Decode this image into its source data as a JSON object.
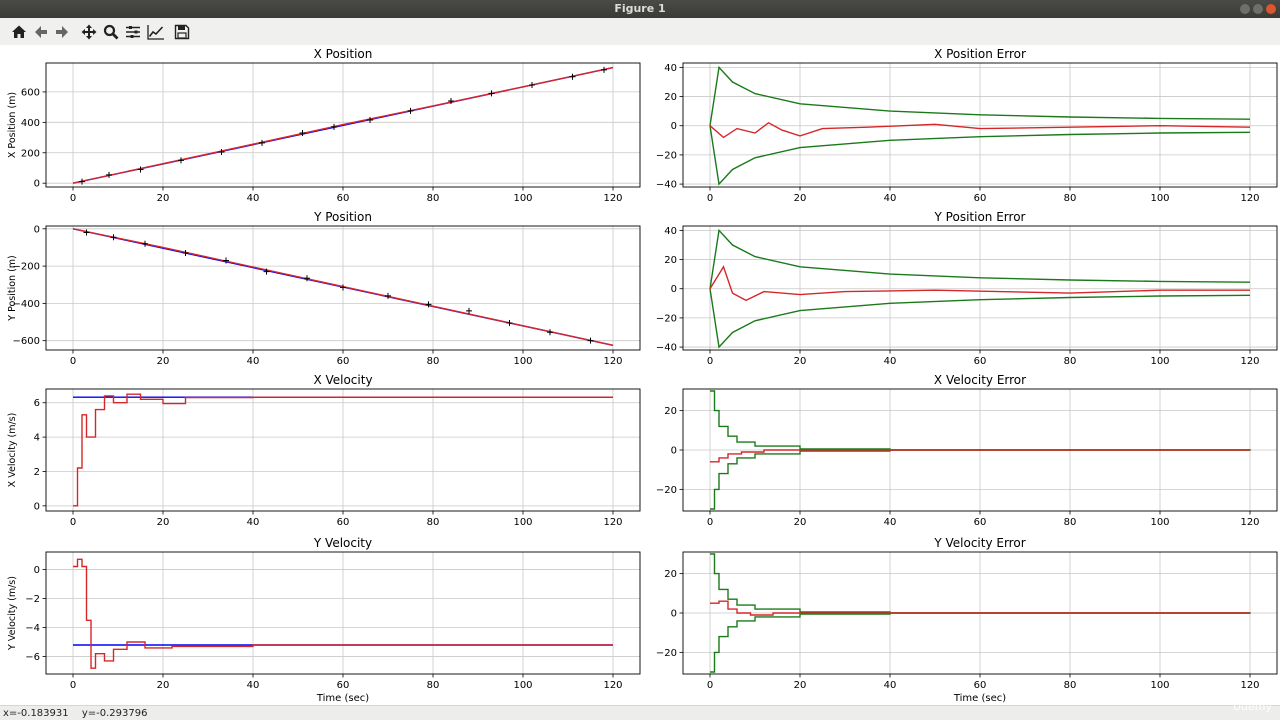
{
  "window": {
    "title": "Figure 1"
  },
  "toolbar": {
    "buttons": [
      {
        "name": "home-icon"
      },
      {
        "name": "back-icon"
      },
      {
        "name": "forward-icon"
      },
      {
        "name": "pan-icon"
      },
      {
        "name": "zoom-icon"
      },
      {
        "name": "subplots-icon"
      },
      {
        "name": "edit-axes-icon"
      },
      {
        "name": "save-icon"
      }
    ]
  },
  "status": {
    "x": "x=-0.183931",
    "y": "y=-0.293796"
  },
  "watermark": "Udemy",
  "colors": {
    "estimate": "#d62728",
    "truth": "#0000ff",
    "measurement": "#000000",
    "bounds": "#1a7a1a"
  },
  "chart_data": [
    {
      "type": "line",
      "title": "X Position",
      "xlabel": "",
      "ylabel": "X Position (m)",
      "xlim": [
        -6,
        126
      ],
      "ylim": [
        -25,
        790
      ],
      "xticks": [
        0,
        20,
        40,
        60,
        80,
        100,
        120
      ],
      "yticks": [
        0,
        200,
        400,
        600
      ],
      "series": [
        {
          "role": "truth",
          "points": [
            [
              0,
              0
            ],
            [
              120,
              760
            ]
          ]
        },
        {
          "role": "estimate",
          "points": [
            [
              0,
              0
            ],
            [
              20,
              128
            ],
            [
              40,
              256
            ],
            [
              60,
              385
            ],
            [
              80,
              508
            ],
            [
              100,
              633
            ],
            [
              120,
              760
            ]
          ]
        },
        {
          "role": "measurement",
          "points": [
            [
              2,
              10
            ],
            [
              8,
              55
            ],
            [
              15,
              90
            ],
            [
              24,
              150
            ],
            [
              33,
              205
            ],
            [
              42,
              265
            ],
            [
              51,
              330
            ],
            [
              58,
              370
            ],
            [
              66,
              415
            ],
            [
              75,
              475
            ],
            [
              84,
              540
            ],
            [
              93,
              590
            ],
            [
              102,
              645
            ],
            [
              111,
              700
            ],
            [
              118,
              745
            ]
          ]
        }
      ]
    },
    {
      "type": "line",
      "title": "X Position Error",
      "xlabel": "",
      "ylabel": "",
      "xlim": [
        -6,
        126
      ],
      "ylim": [
        -42,
        43
      ],
      "xticks": [
        0,
        20,
        40,
        60,
        80,
        100,
        120
      ],
      "yticks": [
        -40,
        -20,
        0,
        20,
        40
      ],
      "series": [
        {
          "role": "bound_upper",
          "points": [
            [
              0,
              0
            ],
            [
              2,
              40
            ],
            [
              5,
              30
            ],
            [
              10,
              22
            ],
            [
              20,
              15
            ],
            [
              40,
              10
            ],
            [
              60,
              7.5
            ],
            [
              80,
              6
            ],
            [
              100,
              5
            ],
            [
              120,
              4.5
            ]
          ]
        },
        {
          "role": "bound_lower",
          "points": [
            [
              0,
              0
            ],
            [
              2,
              -40
            ],
            [
              5,
              -30
            ],
            [
              10,
              -22
            ],
            [
              20,
              -15
            ],
            [
              40,
              -10
            ],
            [
              60,
              -7.5
            ],
            [
              80,
              -6
            ],
            [
              100,
              -5
            ],
            [
              120,
              -4.5
            ]
          ]
        },
        {
          "role": "estimate",
          "points": [
            [
              0,
              0
            ],
            [
              3,
              -8
            ],
            [
              6,
              -2
            ],
            [
              10,
              -5
            ],
            [
              13,
              2
            ],
            [
              16,
              -3
            ],
            [
              20,
              -7
            ],
            [
              25,
              -2
            ],
            [
              35,
              -1
            ],
            [
              50,
              1
            ],
            [
              60,
              -2
            ],
            [
              80,
              -1
            ],
            [
              100,
              0
            ],
            [
              120,
              -1
            ]
          ]
        }
      ]
    },
    {
      "type": "line",
      "title": "Y Position",
      "xlabel": "",
      "ylabel": "Y Position (m)",
      "xlim": [
        -6,
        126
      ],
      "ylim": [
        -650,
        15
      ],
      "xticks": [
        0,
        20,
        40,
        60,
        80,
        100,
        120
      ],
      "yticks": [
        0,
        -200,
        -400,
        -600
      ],
      "series": [
        {
          "role": "truth",
          "points": [
            [
              0,
              0
            ],
            [
              120,
              -625
            ]
          ]
        },
        {
          "role": "estimate",
          "points": [
            [
              0,
              0
            ],
            [
              20,
              -100
            ],
            [
              40,
              -205
            ],
            [
              60,
              -310
            ],
            [
              80,
              -415
            ],
            [
              100,
              -520
            ],
            [
              120,
              -625
            ]
          ]
        },
        {
          "role": "measurement",
          "points": [
            [
              3,
              -20
            ],
            [
              9,
              -45
            ],
            [
              16,
              -80
            ],
            [
              25,
              -130
            ],
            [
              34,
              -170
            ],
            [
              43,
              -230
            ],
            [
              52,
              -265
            ],
            [
              60,
              -315
            ],
            [
              70,
              -360
            ],
            [
              79,
              -405
            ],
            [
              88,
              -440
            ],
            [
              97,
              -505
            ],
            [
              106,
              -555
            ],
            [
              115,
              -600
            ]
          ]
        }
      ]
    },
    {
      "type": "line",
      "title": "Y Position Error",
      "xlabel": "",
      "ylabel": "",
      "xlim": [
        -6,
        126
      ],
      "ylim": [
        -42,
        43
      ],
      "xticks": [
        0,
        20,
        40,
        60,
        80,
        100,
        120
      ],
      "yticks": [
        -40,
        -20,
        0,
        20,
        40
      ],
      "series": [
        {
          "role": "bound_upper",
          "points": [
            [
              0,
              0
            ],
            [
              2,
              40
            ],
            [
              5,
              30
            ],
            [
              10,
              22
            ],
            [
              20,
              15
            ],
            [
              40,
              10
            ],
            [
              60,
              7.5
            ],
            [
              80,
              6
            ],
            [
              100,
              5
            ],
            [
              120,
              4.5
            ]
          ]
        },
        {
          "role": "bound_lower",
          "points": [
            [
              0,
              0
            ],
            [
              2,
              -40
            ],
            [
              5,
              -30
            ],
            [
              10,
              -22
            ],
            [
              20,
              -15
            ],
            [
              40,
              -10
            ],
            [
              60,
              -7.5
            ],
            [
              80,
              -6
            ],
            [
              100,
              -5
            ],
            [
              120,
              -4.5
            ]
          ]
        },
        {
          "role": "estimate",
          "points": [
            [
              0,
              0
            ],
            [
              2,
              10
            ],
            [
              3,
              15
            ],
            [
              5,
              -3
            ],
            [
              8,
              -8
            ],
            [
              12,
              -2
            ],
            [
              20,
              -4
            ],
            [
              30,
              -2
            ],
            [
              50,
              -1
            ],
            [
              80,
              -3
            ],
            [
              100,
              -1
            ],
            [
              120,
              -1
            ]
          ]
        }
      ]
    },
    {
      "type": "line",
      "title": "X Velocity",
      "xlabel": "",
      "ylabel": "X Velocity (m/s)",
      "xlim": [
        -6,
        126
      ],
      "ylim": [
        -0.3,
        6.8
      ],
      "xticks": [
        0,
        20,
        40,
        60,
        80,
        100,
        120
      ],
      "yticks": [
        0,
        2,
        4,
        6
      ],
      "series": [
        {
          "role": "truth",
          "points": [
            [
              0,
              6.32
            ],
            [
              120,
              6.32
            ]
          ]
        },
        {
          "role": "estimate",
          "step": true,
          "points": [
            [
              0,
              0
            ],
            [
              1,
              2.2
            ],
            [
              2,
              5.3
            ],
            [
              3,
              4
            ],
            [
              5,
              5.6
            ],
            [
              7,
              6.4
            ],
            [
              9,
              6
            ],
            [
              12,
              6.5
            ],
            [
              15,
              6.2
            ],
            [
              20,
              5.95
            ],
            [
              25,
              6.3
            ],
            [
              40,
              6.32
            ],
            [
              120,
              6.32
            ]
          ]
        }
      ]
    },
    {
      "type": "line",
      "title": "X Velocity Error",
      "xlabel": "",
      "ylabel": "",
      "xlim": [
        -6,
        126
      ],
      "ylim": [
        -31,
        31
      ],
      "xticks": [
        0,
        20,
        40,
        60,
        80,
        100,
        120
      ],
      "yticks": [
        -20,
        0,
        20
      ],
      "series": [
        {
          "role": "bound_upper",
          "step": true,
          "points": [
            [
              0,
              30
            ],
            [
              1,
              20
            ],
            [
              2,
              12
            ],
            [
              4,
              7
            ],
            [
              6,
              4
            ],
            [
              10,
              2
            ],
            [
              20,
              0.5
            ],
            [
              40,
              0.1
            ],
            [
              120,
              0.05
            ]
          ]
        },
        {
          "role": "bound_lower",
          "step": true,
          "points": [
            [
              0,
              -30
            ],
            [
              1,
              -20
            ],
            [
              2,
              -12
            ],
            [
              4,
              -7
            ],
            [
              6,
              -4
            ],
            [
              10,
              -2
            ],
            [
              20,
              -0.5
            ],
            [
              40,
              -0.1
            ],
            [
              120,
              -0.05
            ]
          ]
        },
        {
          "role": "estimate",
          "step": true,
          "points": [
            [
              0,
              -6
            ],
            [
              2,
              -4
            ],
            [
              4,
              -2
            ],
            [
              7,
              -1
            ],
            [
              12,
              0
            ],
            [
              120,
              0
            ]
          ]
        }
      ]
    },
    {
      "type": "line",
      "title": "Y Velocity",
      "xlabel": "Time (sec)",
      "ylabel": "Y Velocity (m/s)",
      "xlim": [
        -6,
        126
      ],
      "ylim": [
        -7.2,
        1.2
      ],
      "xticks": [
        0,
        20,
        40,
        60,
        80,
        100,
        120
      ],
      "yticks": [
        0,
        -2,
        -4,
        -6
      ],
      "series": [
        {
          "role": "truth",
          "points": [
            [
              0,
              -5.2
            ],
            [
              120,
              -5.2
            ]
          ]
        },
        {
          "role": "estimate",
          "step": true,
          "points": [
            [
              0,
              0.2
            ],
            [
              1,
              0.7
            ],
            [
              2,
              0.2
            ],
            [
              3,
              -3.5
            ],
            [
              4,
              -6.8
            ],
            [
              5,
              -5.8
            ],
            [
              7,
              -6.3
            ],
            [
              9,
              -5.5
            ],
            [
              12,
              -5
            ],
            [
              16,
              -5.4
            ],
            [
              22,
              -5.3
            ],
            [
              40,
              -5.2
            ],
            [
              120,
              -5.2
            ]
          ]
        }
      ]
    },
    {
      "type": "line",
      "title": "Y Velocity Error",
      "xlabel": "Time (sec)",
      "ylabel": "",
      "xlim": [
        -6,
        126
      ],
      "ylim": [
        -31,
        31
      ],
      "xticks": [
        0,
        20,
        40,
        60,
        80,
        100,
        120
      ],
      "yticks": [
        -20,
        0,
        20
      ],
      "series": [
        {
          "role": "bound_upper",
          "step": true,
          "points": [
            [
              0,
              30
            ],
            [
              1,
              20
            ],
            [
              2,
              12
            ],
            [
              4,
              7
            ],
            [
              6,
              4
            ],
            [
              10,
              2
            ],
            [
              20,
              0.5
            ],
            [
              40,
              0.1
            ],
            [
              120,
              0.05
            ]
          ]
        },
        {
          "role": "bound_lower",
          "step": true,
          "points": [
            [
              0,
              -30
            ],
            [
              1,
              -20
            ],
            [
              2,
              -12
            ],
            [
              4,
              -7
            ],
            [
              6,
              -4
            ],
            [
              10,
              -2
            ],
            [
              20,
              -0.5
            ],
            [
              40,
              -0.1
            ],
            [
              120,
              -0.05
            ]
          ]
        },
        {
          "role": "estimate",
          "step": true,
          "points": [
            [
              0,
              5
            ],
            [
              2,
              6
            ],
            [
              4,
              2
            ],
            [
              6,
              0
            ],
            [
              9,
              -1
            ],
            [
              14,
              0
            ],
            [
              120,
              0
            ]
          ]
        }
      ]
    }
  ]
}
